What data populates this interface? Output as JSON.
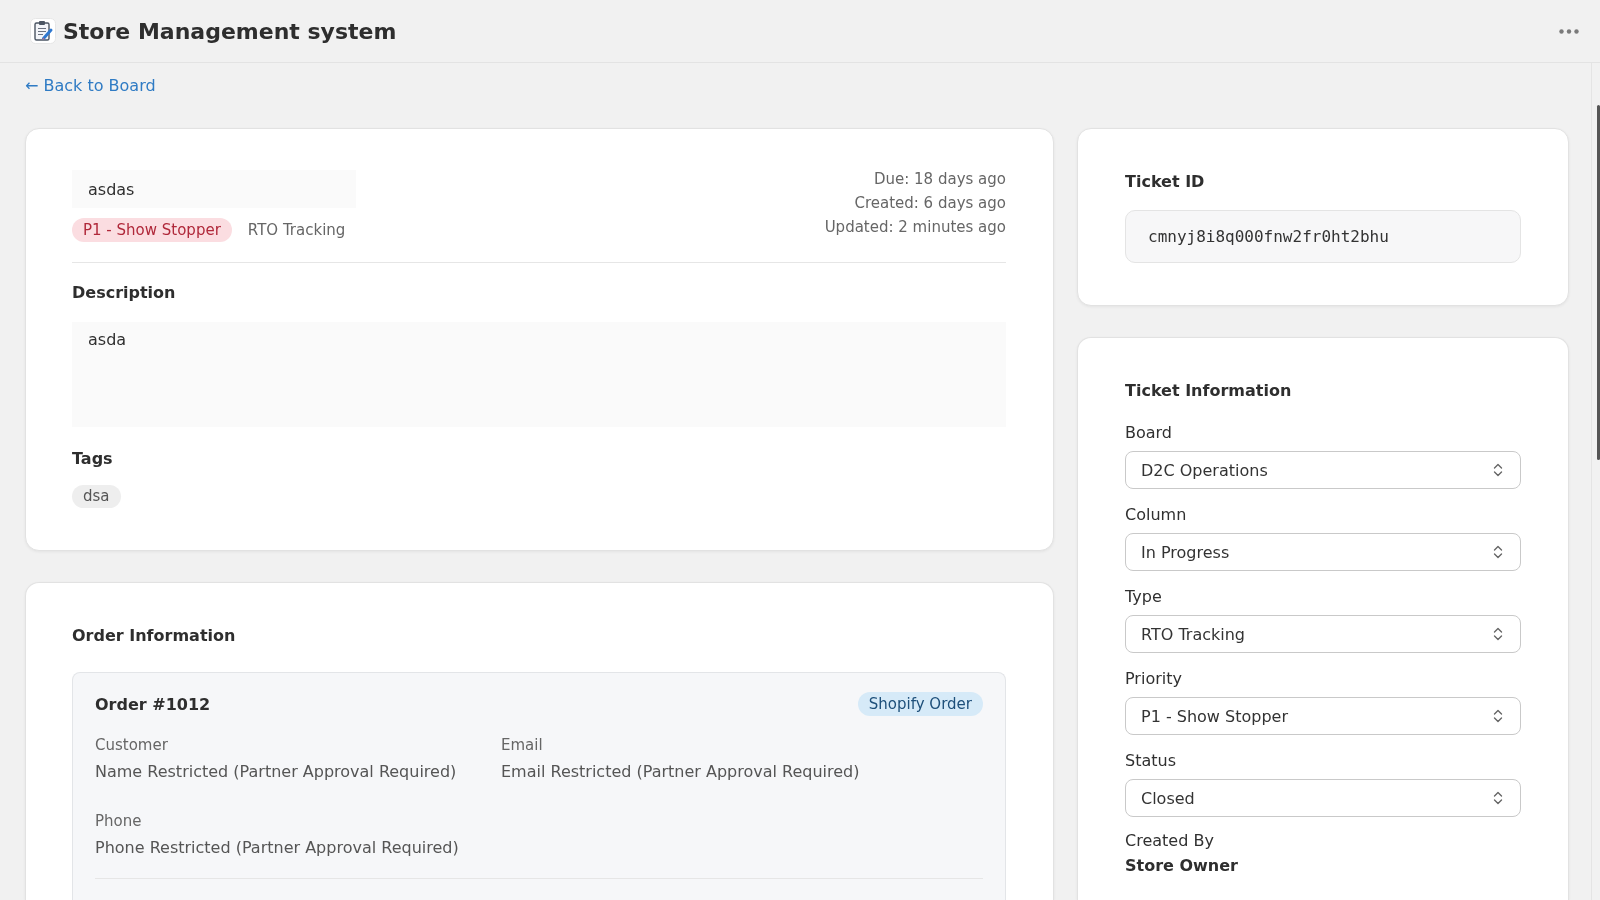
{
  "header": {
    "title": "Store Management system"
  },
  "back_link": {
    "label": "← Back to Board"
  },
  "ticket": {
    "title": "asdas",
    "priority": "P1 - Show Stopper",
    "type": "RTO Tracking",
    "dates": [
      "Due: 18 days ago",
      "Created: 6 days ago",
      "Updated: 2 minutes ago"
    ],
    "description": {
      "heading": "Description",
      "value": "asda"
    },
    "tags": {
      "heading": "Tags",
      "items": [
        "dsa"
      ]
    }
  },
  "order_information": {
    "heading": "Order Information",
    "order": {
      "title": "Order #1012",
      "badge": "Shopify Order",
      "fields": [
        {
          "label": "Customer",
          "value": "Name Restricted (Partner Approval Required)"
        },
        {
          "label": "Email",
          "value": "Email Restricted (Partner Approval Required)"
        },
        {
          "label": "Phone",
          "value": "Phone Restricted (Partner Approval Required)"
        }
      ]
    }
  },
  "ticket_id": {
    "heading": "Ticket ID",
    "value": "cmnyj8i8q000fnw2fr0ht2bhu"
  },
  "ticket_information": {
    "heading": "Ticket Information",
    "fields": [
      {
        "label": "Board",
        "value": "D2C Operations"
      },
      {
        "label": "Column",
        "value": "In Progress"
      },
      {
        "label": "Type",
        "value": "RTO Tracking"
      },
      {
        "label": "Priority",
        "value": "P1 - Show Stopper"
      },
      {
        "label": "Status",
        "value": "Closed"
      }
    ],
    "created_by": {
      "label": "Created By",
      "value": "Store Owner"
    }
  }
}
